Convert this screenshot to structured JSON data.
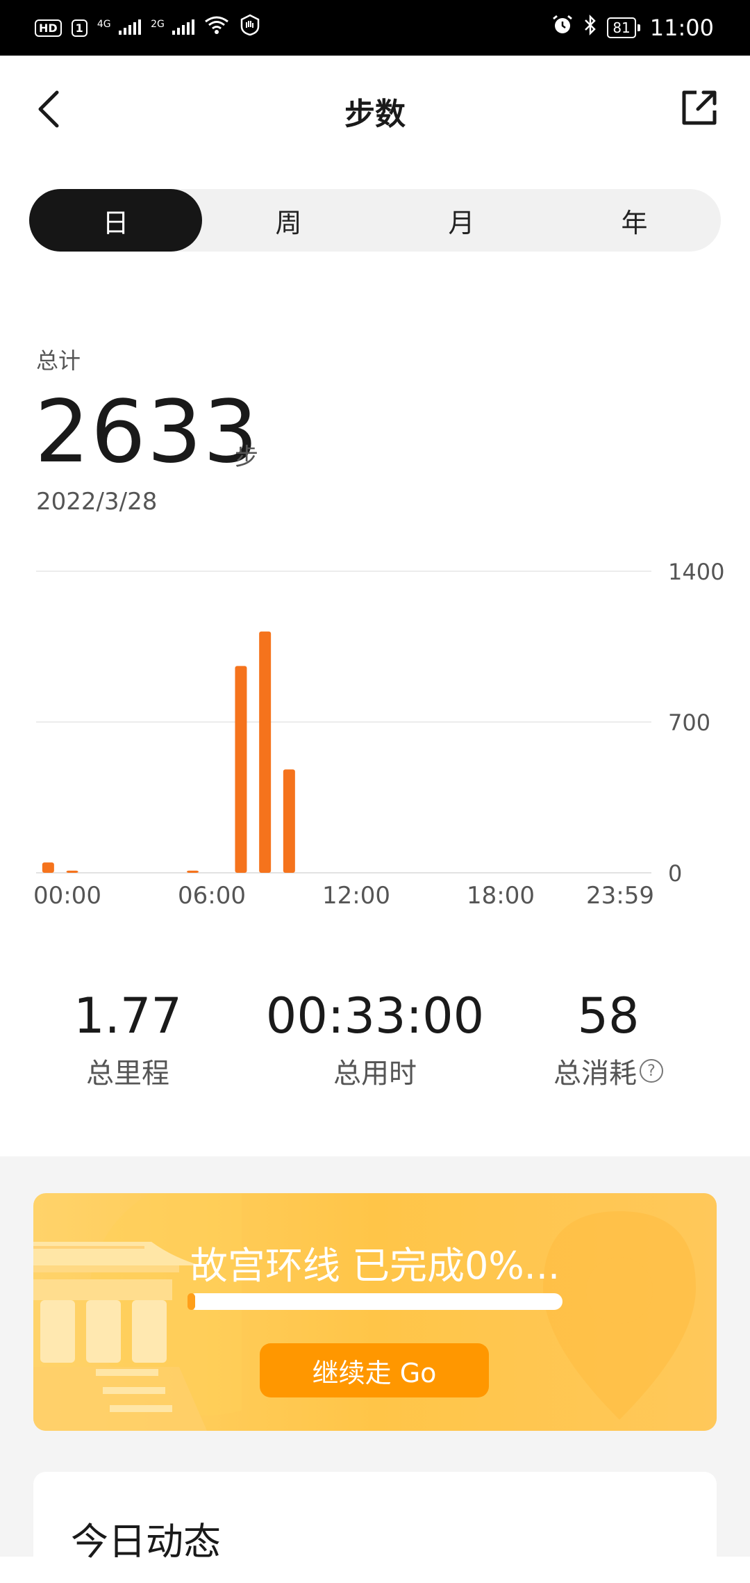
{
  "status_bar": {
    "hd_label": "HD",
    "sim_label": "1",
    "network1": "4G",
    "network2": "2G",
    "battery": "81",
    "time": "11:00"
  },
  "header": {
    "title": "步数"
  },
  "tabs": [
    {
      "label": "日",
      "active": true
    },
    {
      "label": "周",
      "active": false
    },
    {
      "label": "月",
      "active": false
    },
    {
      "label": "年",
      "active": false
    }
  ],
  "summary": {
    "total_label": "总计",
    "total_value": "2633",
    "unit": "步",
    "date": "2022/3/28"
  },
  "chart_data": {
    "type": "bar",
    "x_labels": [
      "00:00",
      "06:00",
      "12:00",
      "18:00",
      "23:59"
    ],
    "y_ticks": [
      1400,
      700,
      0
    ],
    "ylim": [
      0,
      1400
    ],
    "grid": true,
    "color": "#f5731c",
    "series": [
      {
        "values": [
          48,
          10,
          0,
          0,
          0,
          0,
          10,
          0,
          960,
          1120,
          480,
          0,
          0,
          0,
          0,
          0,
          0,
          0,
          0,
          0,
          0,
          0,
          0,
          0
        ]
      }
    ]
  },
  "stats": [
    {
      "value": "1.77",
      "label": "总里程",
      "help": false
    },
    {
      "value": "00:33:00",
      "label": "总用时",
      "help": false
    },
    {
      "value": "58",
      "label": "总消耗",
      "help": true
    }
  ],
  "banner": {
    "title": "故宫环线 已完成0%...",
    "progress": 0.02,
    "button_label": "继续走 Go"
  },
  "card": {
    "title": "今日动态"
  },
  "colors": {
    "accent": "#f5731c",
    "tab_active_bg": "#161616",
    "banner": "#ffc548",
    "button": "#ff9700"
  }
}
